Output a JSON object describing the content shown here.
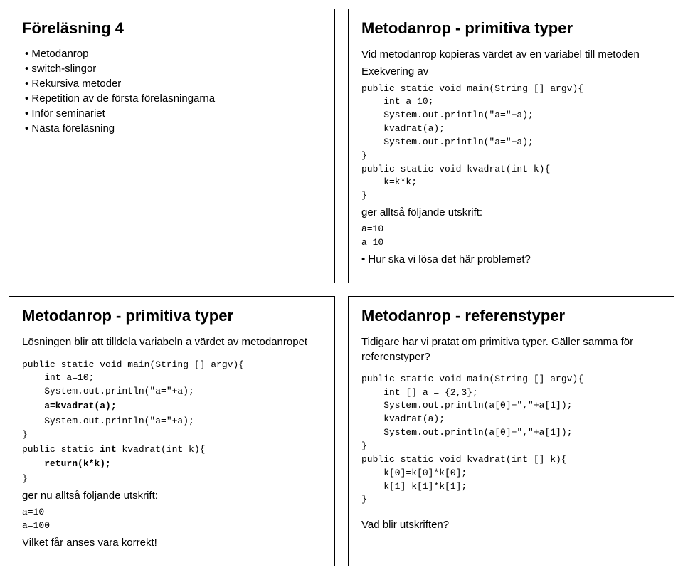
{
  "p1": {
    "title": "Föreläsning 4",
    "bullets": [
      "• Metodanrop",
      "• switch-slingor",
      "• Rekursiva metoder",
      "• Repetition av de första föreläsningarna",
      "• Inför seminariet",
      "• Nästa föreläsning"
    ]
  },
  "p2": {
    "title": "Metodanrop - primitiva typer",
    "intro1": "Vid metodanrop kopieras värdet av en variabel till metoden",
    "intro2": "Exekvering av",
    "code1": "public static void main(String [] argv){\n    int a=10;\n    System.out.println(\"a=\"+a);\n    kvadrat(a);\n    System.out.println(\"a=\"+a);\n}\npublic static void kvadrat(int k){\n    k=k*k;\n}",
    "after1": "ger alltså följande utskrift:",
    "out": "a=10\na=10",
    "bullet": "• Hur ska vi lösa det här problemet?"
  },
  "p3": {
    "title": "Metodanrop - primitiva typer",
    "intro": "Lösningen blir att tilldela variabeln a värdet av metodanropet",
    "code_head": "public static void main(String [] argv){\n    int a=10;\n    System.out.println(\"a=\"+a);",
    "code_bold1": "    a=kvadrat(a);",
    "code_mid": "    System.out.println(\"a=\"+a);\n}",
    "code_sig": "public static int kvadrat(int k){",
    "code_bold2": "    return(k*k);",
    "code_tail": "}",
    "after1": "ger nu alltså följande utskrift:",
    "out": "a=10\na=100",
    "final": "Vilket får anses vara korrekt!"
  },
  "p4": {
    "title": "Metodanrop - referenstyper",
    "intro": "Tidigare har vi pratat om primitiva typer. Gäller samma för referenstyper?",
    "code": "public static void main(String [] argv){\n    int [] a = {2,3};\n    System.out.println(a[0]+\",\"+a[1]);\n    kvadrat(a);\n    System.out.println(a[0]+\",\"+a[1]);\n}\npublic static void kvadrat(int [] k){\n    k[0]=k[0]*k[0];\n    k[1]=k[1]*k[1];\n}",
    "final": "Vad blir utskriften?"
  }
}
